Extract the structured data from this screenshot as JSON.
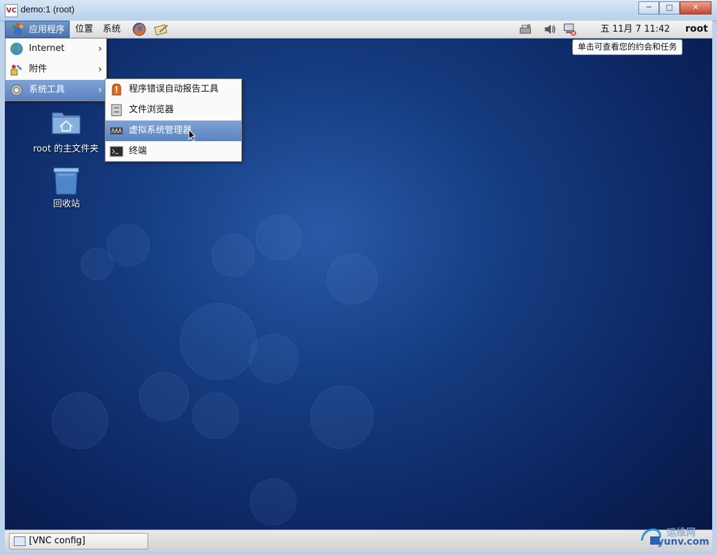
{
  "window": {
    "title": "demo:1 (root)",
    "logo_text": "VC",
    "buttons": {
      "minimize": "─",
      "maximize": "□",
      "close": "✕"
    }
  },
  "panel": {
    "menus": [
      "应用程序",
      "位置",
      "系统"
    ],
    "clock": "五 11月  7 11:42",
    "user": "root",
    "tooltip": "单击可查看您的约会和任务"
  },
  "apps_menu": {
    "items": [
      {
        "label": "Internet",
        "icon": "globe-icon",
        "has_submenu": true
      },
      {
        "label": "附件",
        "icon": "accessories-icon",
        "has_submenu": true
      },
      {
        "label": "系统工具",
        "icon": "gear-icon",
        "has_submenu": true,
        "highlighted": true
      }
    ],
    "arrow": "›"
  },
  "system_tools_menu": {
    "items": [
      {
        "label": "程序错误自动报告工具",
        "icon": "bug-report-icon"
      },
      {
        "label": "文件浏览器",
        "icon": "file-cabinet-icon"
      },
      {
        "label": "虚拟系统管理器",
        "icon": "virt-manager-icon",
        "highlighted": true
      },
      {
        "label": "终端",
        "icon": "terminal-icon"
      }
    ]
  },
  "desktop_icons": [
    {
      "label": "root 的主文件夹",
      "icon": "home-folder-icon"
    },
    {
      "label": "回收站",
      "icon": "trash-icon"
    }
  ],
  "taskbar": {
    "items": [
      {
        "label": "[VNC config]",
        "icon": "window-icon"
      }
    ]
  },
  "watermark": {
    "line1": "运维网",
    "line2": "iyunv.com"
  },
  "colors": {
    "desktop": "#153c80",
    "highlight": "#5a83c0",
    "panel": "#dcdcdc"
  }
}
